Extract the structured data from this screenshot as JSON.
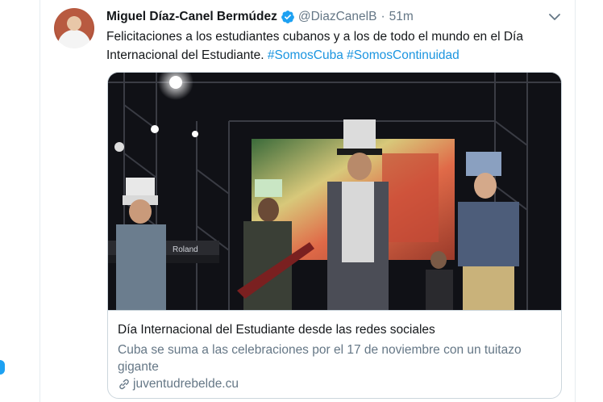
{
  "tweet": {
    "author_name": "Miguel Díaz-Canel Bermúdez",
    "handle": "@DiazCanelB",
    "separator": "·",
    "time": "51m",
    "text_main": "Felicitaciones a los estudiantes cubanos y a los de todo el mundo en el Día Internacional del Estudiante. ",
    "hashtags": [
      "#SomosCuba",
      "#SomosContinuidad"
    ]
  },
  "card": {
    "title": "Día Internacional del Estudiante desde las redes sociales",
    "description": "Cuba se suma a las celebraciones por el 17 de noviembre con un tuitazo gigante",
    "domain": "juventudrebelde.cu",
    "keyboard_brand": "Roland"
  },
  "colors": {
    "link": "#1b95e0",
    "verified": "#1da1f2",
    "secondary_text": "#657786",
    "border": "#ccd6dd"
  },
  "icons": {
    "verified": "verified-badge-icon",
    "caret": "chevron-down-icon",
    "link": "link-icon"
  }
}
